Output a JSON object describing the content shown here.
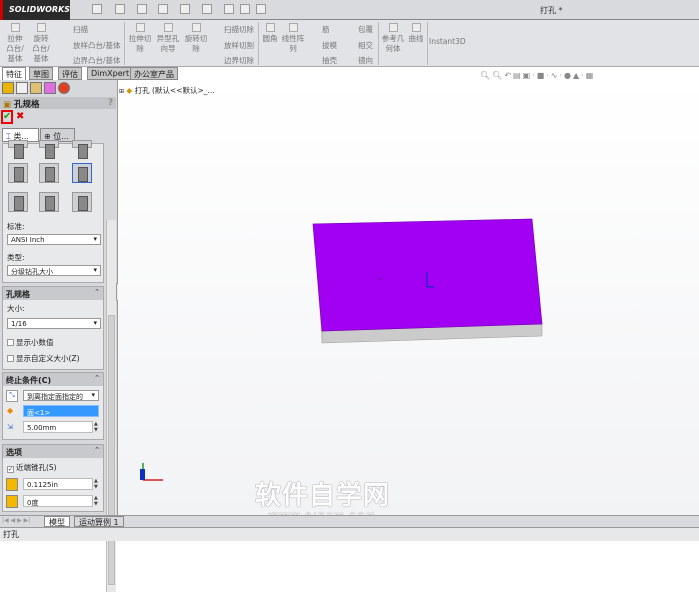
{
  "app": {
    "logo": "SOLIDWORKS",
    "doc_title": "打孔 *"
  },
  "ribbon": {
    "extrude_boss": "拉伸凸台/基体",
    "revolve_boss": "旋转凸台/基体",
    "sweep": "扫描",
    "loft": "放样凸台/基体",
    "boundary": "边界凸台/基体",
    "extrude_cut": "拉伸切除",
    "hole_wizard": "异型孔向导",
    "revolve_cut": "旋转切除",
    "sweep_cut": "扫描切除",
    "loft_cut": "放样切割",
    "boundary_cut": "边界切除",
    "fillet": "圆角",
    "linear_pattern": "线性阵列",
    "rib": "筋",
    "draft": "拔模",
    "shell": "抽壳",
    "wrap": "包覆",
    "intersect": "相交",
    "mirror": "镜向",
    "ref_geometry": "参考几何体",
    "curves": "曲线",
    "instant3d": "Instant3D"
  },
  "tabs": [
    "特征",
    "草图",
    "评估",
    "DimXpert",
    "办公室产品"
  ],
  "tree": {
    "root": "打孔 (默认<<默认>_..."
  },
  "panel": {
    "title": "孔规格",
    "help": "?",
    "subtabs": [
      "类...",
      "位..."
    ],
    "standard_label": "标准:",
    "standard_value": "ANSI Inch",
    "type_label": "类型:",
    "type_value": "分级钻孔大小",
    "spec": {
      "title": "孔规格",
      "size_label": "大小:",
      "size_value": "1/16",
      "show_decimal": "显示小数值",
      "show_custom": "显示自定义大小(Z)"
    },
    "end": {
      "title": "终止条件(C)",
      "condition": "到离指定面指定的",
      "face": "面<1>",
      "depth": "5.00mm"
    },
    "options": {
      "title": "选项",
      "near_counterbore": "近端锥孔(S)",
      "diameter": "0.1125in",
      "angle": "0度"
    }
  },
  "bottom_tabs": [
    "模型",
    "运动算例 1"
  ],
  "status": "打孔",
  "watermark": {
    "cn": "软件自学网",
    "url": "WWW.RJZXW.COM"
  },
  "colors": {
    "face": "#a100f2",
    "side": "#c8c8c8"
  }
}
